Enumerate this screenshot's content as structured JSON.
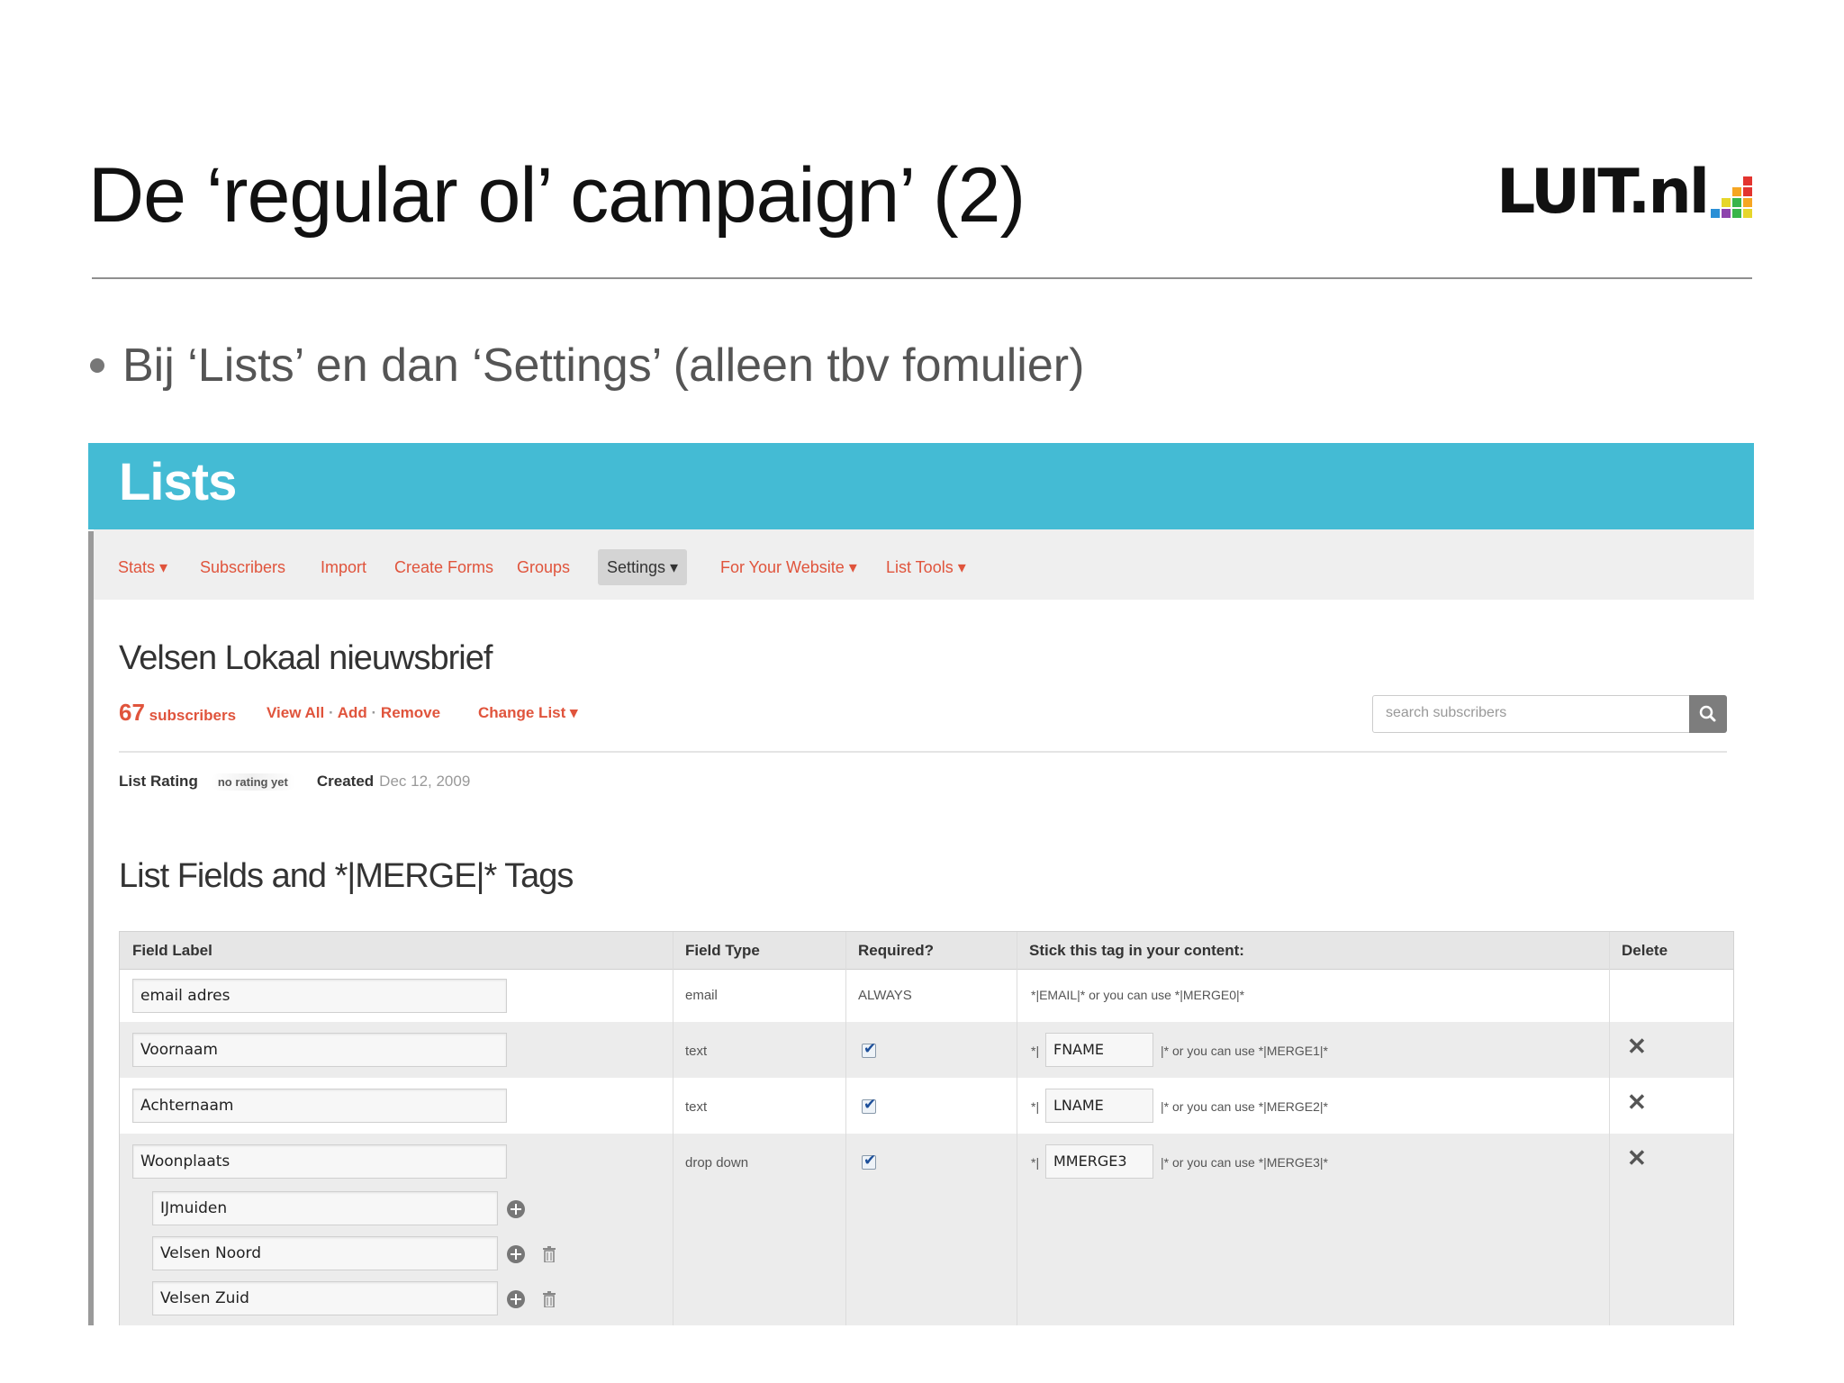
{
  "slide": {
    "title": "De ‘regular ol’ campaign’ (2)",
    "logo_text": "LUIT.nl",
    "bullet": "Bij ‘Lists’ en dan ‘Settings’ (alleen tbv fomulier)"
  },
  "colors": {
    "header_band": "#44bbd4",
    "link": "#e0543c",
    "logo_bars": [
      "#e3342f",
      "#f6a623",
      "#e6d62b",
      "#39b54a",
      "#2a8fd6",
      "#8e44ad"
    ]
  },
  "app": {
    "header_title": "Lists",
    "nav": {
      "stats": "Stats ▾",
      "subscribers": "Subscribers",
      "import": "Import",
      "create_forms": "Create Forms",
      "groups": "Groups",
      "settings": "Settings ▾",
      "for_your_website": "For Your Website ▾",
      "list_tools": "List Tools ▾"
    },
    "list_name": "Velsen Lokaal nieuwsbrief",
    "subscriber_count": "67",
    "subscribers_label": "subscribers",
    "view_all": "View All",
    "add": "Add",
    "remove": "Remove",
    "change_list": "Change List ▾",
    "search_placeholder": "search subscribers",
    "list_rating_label": "List Rating",
    "no_rating": "no rating yet",
    "created_label": "Created",
    "created_date": "Dec 12, 2009",
    "fields_title": "List Fields and *|MERGE|* Tags",
    "table": {
      "headers": {
        "field_label": "Field Label",
        "field_type": "Field Type",
        "required": "Required?",
        "tag": "Stick this tag in your content:",
        "delete": "Delete"
      },
      "rows": [
        {
          "label": "email adres",
          "type": "email",
          "required": "ALWAYS",
          "tag_text": "*|EMAIL|* or you can use *|MERGE0|*"
        },
        {
          "label": "Voornaam",
          "type": "text",
          "required": true,
          "tag_prefix": "*|",
          "tag": "FNAME",
          "tag_suffix": "|* or you can use *|MERGE1|*"
        },
        {
          "label": "Achternaam",
          "type": "text",
          "required": true,
          "tag_prefix": "*|",
          "tag": "LNAME",
          "tag_suffix": "|* or you can use *|MERGE2|*"
        },
        {
          "label": "Woonplaats",
          "type": "drop down",
          "required": true,
          "tag_prefix": "*|",
          "tag": "MMERGE3",
          "tag_suffix": "|* or you can use *|MERGE3|*",
          "options": [
            "IJmuiden",
            "Velsen Noord",
            "Velsen Zuid"
          ]
        }
      ]
    }
  }
}
